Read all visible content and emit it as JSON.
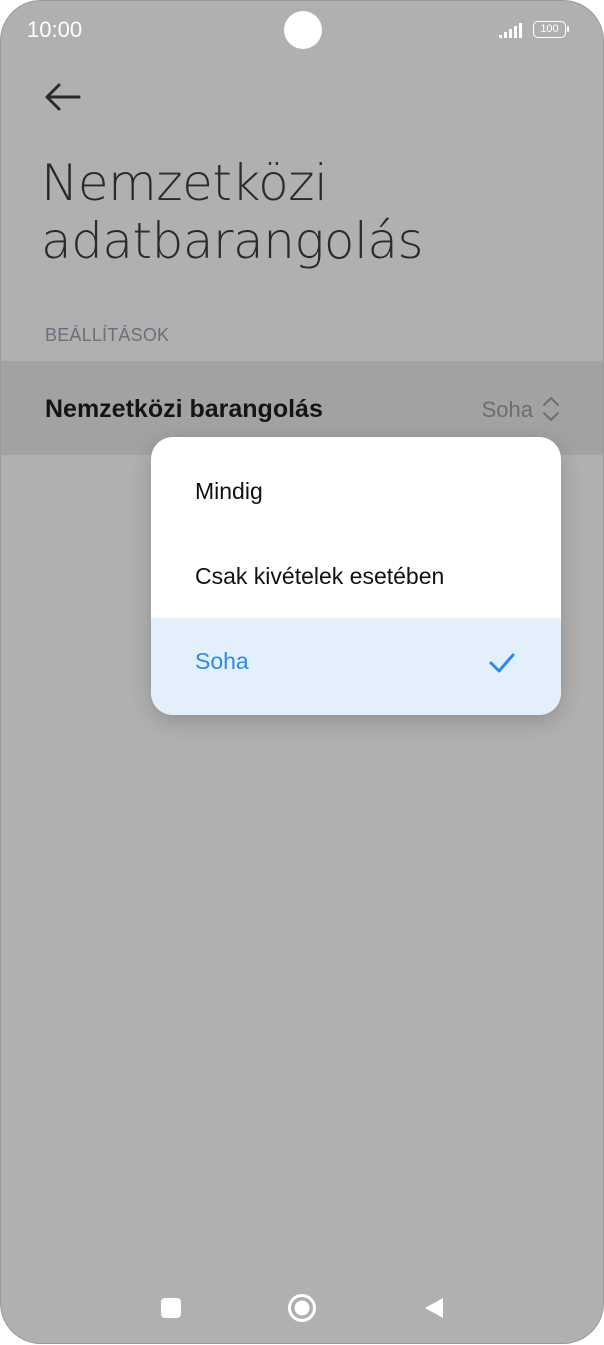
{
  "status_bar": {
    "time": "10:00",
    "battery_level": "100"
  },
  "header": {
    "back_icon": "arrow-left-icon",
    "title": "Nemzetközi adatbarangolás"
  },
  "section": {
    "label": "BEÁLLÍTÁSOK"
  },
  "setting": {
    "title": "Nemzetközi barangolás",
    "value": "Soha",
    "icon": "chevron-up-down-icon"
  },
  "dropdown": {
    "options": [
      {
        "label": "Mindig",
        "selected": false
      },
      {
        "label": "Csak kivételek esetében",
        "selected": false
      },
      {
        "label": "Soha",
        "selected": true
      }
    ],
    "check_icon": "checkmark-icon"
  },
  "colors": {
    "scrim": "#b0b0b0",
    "accent": "#2a8ce6",
    "selected_bg": "#e3f0fc"
  },
  "nav_bar": {
    "icons": [
      "recents-square-icon",
      "home-circle-icon",
      "back-triangle-icon"
    ]
  }
}
